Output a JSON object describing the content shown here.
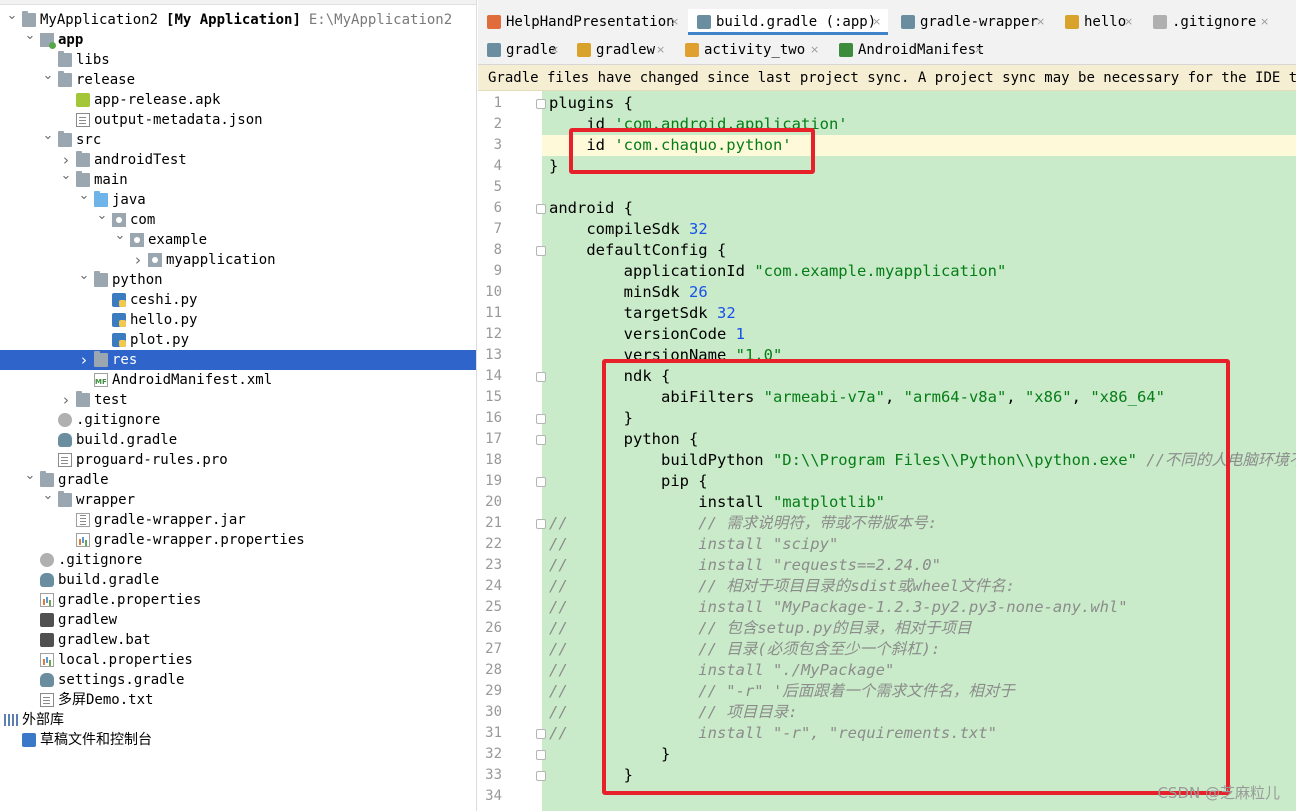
{
  "project_tree": {
    "root_name": "MyApplication2",
    "root_module": "[My Application]",
    "root_path": "E:\\MyApplication2",
    "items": [
      {
        "label": "app",
        "bold": true
      },
      {
        "label": "libs"
      },
      {
        "label": "release"
      },
      {
        "label": "app-release.apk"
      },
      {
        "label": "output-metadata.json"
      },
      {
        "label": "src"
      },
      {
        "label": "androidTest"
      },
      {
        "label": "main"
      },
      {
        "label": "java"
      },
      {
        "label": "com"
      },
      {
        "label": "example"
      },
      {
        "label": "myapplication"
      },
      {
        "label": "python"
      },
      {
        "label": "ceshi.py"
      },
      {
        "label": "hello.py"
      },
      {
        "label": "plot.py"
      },
      {
        "label": "res",
        "selected": true
      },
      {
        "label": "AndroidManifest.xml"
      },
      {
        "label": "test"
      },
      {
        "label": ".gitignore"
      },
      {
        "label": "build.gradle"
      },
      {
        "label": "proguard-rules.pro"
      },
      {
        "label": "gradle"
      },
      {
        "label": "wrapper"
      },
      {
        "label": "gradle-wrapper.jar"
      },
      {
        "label": "gradle-wrapper.properties"
      },
      {
        "label": ".gitignore"
      },
      {
        "label": "build.gradle"
      },
      {
        "label": "gradle.properties"
      },
      {
        "label": "gradlew"
      },
      {
        "label": "gradlew.bat"
      },
      {
        "label": "local.properties"
      },
      {
        "label": "settings.gradle"
      },
      {
        "label": "多屏Demo.txt"
      },
      {
        "label": "外部库"
      },
      {
        "label": "草稿文件和控制台"
      }
    ]
  },
  "tabs": {
    "row1": [
      {
        "label": "HelpHandPresentation"
      },
      {
        "label": "build.gradle (:app)",
        "active": true
      },
      {
        "label": "gradle-wrapper"
      },
      {
        "label": "hello"
      },
      {
        "label": ".gitignore"
      }
    ],
    "row2": [
      {
        "label": "gradle"
      },
      {
        "label": "gradlew"
      },
      {
        "label": "activity_two"
      },
      {
        "label": "AndroidManifest"
      }
    ],
    "close_glyph": "×"
  },
  "banner": {
    "text": "Gradle files have changed since last project sync. A project sync may be necessary for the IDE to wor"
  },
  "editor": {
    "current_line": 3,
    "lines": [
      "plugins {",
      "    id 'com.android.application'",
      "    id 'com.chaquo.python'",
      "}",
      "",
      "android {",
      "    compileSdk 32",
      "    defaultConfig {",
      "        applicationId \"com.example.myapplication\"",
      "        minSdk 26",
      "        targetSdk 32",
      "        versionCode 1",
      "        versionName \"1.0\"",
      "        ndk {",
      "            abiFilters \"armeabi-v7a\", \"arm64-v8a\", \"x86\", \"x86_64\"",
      "        }",
      "        python {",
      "            buildPython \"D:\\\\Program Files\\\\Python\\\\python.exe\" //不同的人电脑环境不同",
      "            pip {",
      "                install \"matplotlib\"",
      "//              // 需求说明符，带或不带版本号:",
      "//              install \"scipy\"",
      "//              install \"requests==2.24.0\"",
      "//              // 相对于项目目录的sdist或wheel文件名:",
      "//              install \"MyPackage-1.2.3-py2.py3-none-any.whl\"",
      "//              // 包含setup.py的目录，相对于项目",
      "//              // 目录(必须包含至少一个斜杠):",
      "//              install \"./MyPackage\"",
      "//              // \"-r\" '后面跟着一个需求文件名，相对于",
      "//              // 项目目录:",
      "//              install \"-r\", \"requirements.txt\"",
      "            }",
      "        }",
      ""
    ]
  },
  "watermark": "CSDN @芝麻粒儿",
  "colors": {
    "selection": "#2f65ca",
    "code_background": "#c9ebc9",
    "string": "#067d17",
    "number": "#1750eb",
    "comment": "#8c8c8c",
    "annotation_box": "#e8202a",
    "banner_background": "#f5eed3"
  }
}
